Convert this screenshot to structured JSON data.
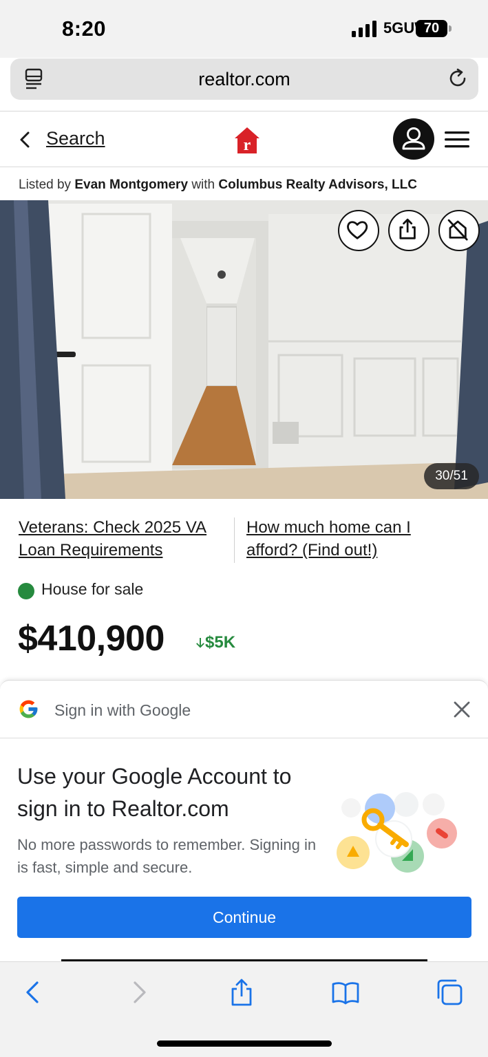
{
  "status_bar": {
    "time": "8:20",
    "network": "5GUW",
    "battery": "70"
  },
  "browser": {
    "url": "realtor.com"
  },
  "header": {
    "back_label": "Search",
    "brand_color": "#d92228"
  },
  "listing": {
    "listed_by_prefix": "Listed by",
    "agent": "Evan Montgomery",
    "with": "with",
    "brokerage": "Columbus Realty Advisors, LLC",
    "photo_counter": "30/51",
    "links": [
      {
        "label": "Veterans: Check 2025 VA Loan Requirements"
      },
      {
        "label": "How much home can I afford? (Find out!)"
      }
    ],
    "status": "House for sale",
    "status_color": "#268a3e",
    "price": "$410,900",
    "price_change": "$5K"
  },
  "google_signin": {
    "title": "Sign in with Google",
    "heading": "Use your Google Account to sign in to Realtor.com",
    "subtext": "No more passwords to remember. Signing in is fast, simple and secure.",
    "continue_label": "Continue",
    "button_color": "#1a73e8"
  },
  "toolbar": {
    "icons": [
      "back-icon",
      "forward-icon",
      "share-icon",
      "bookmarks-icon",
      "tabs-icon"
    ]
  }
}
